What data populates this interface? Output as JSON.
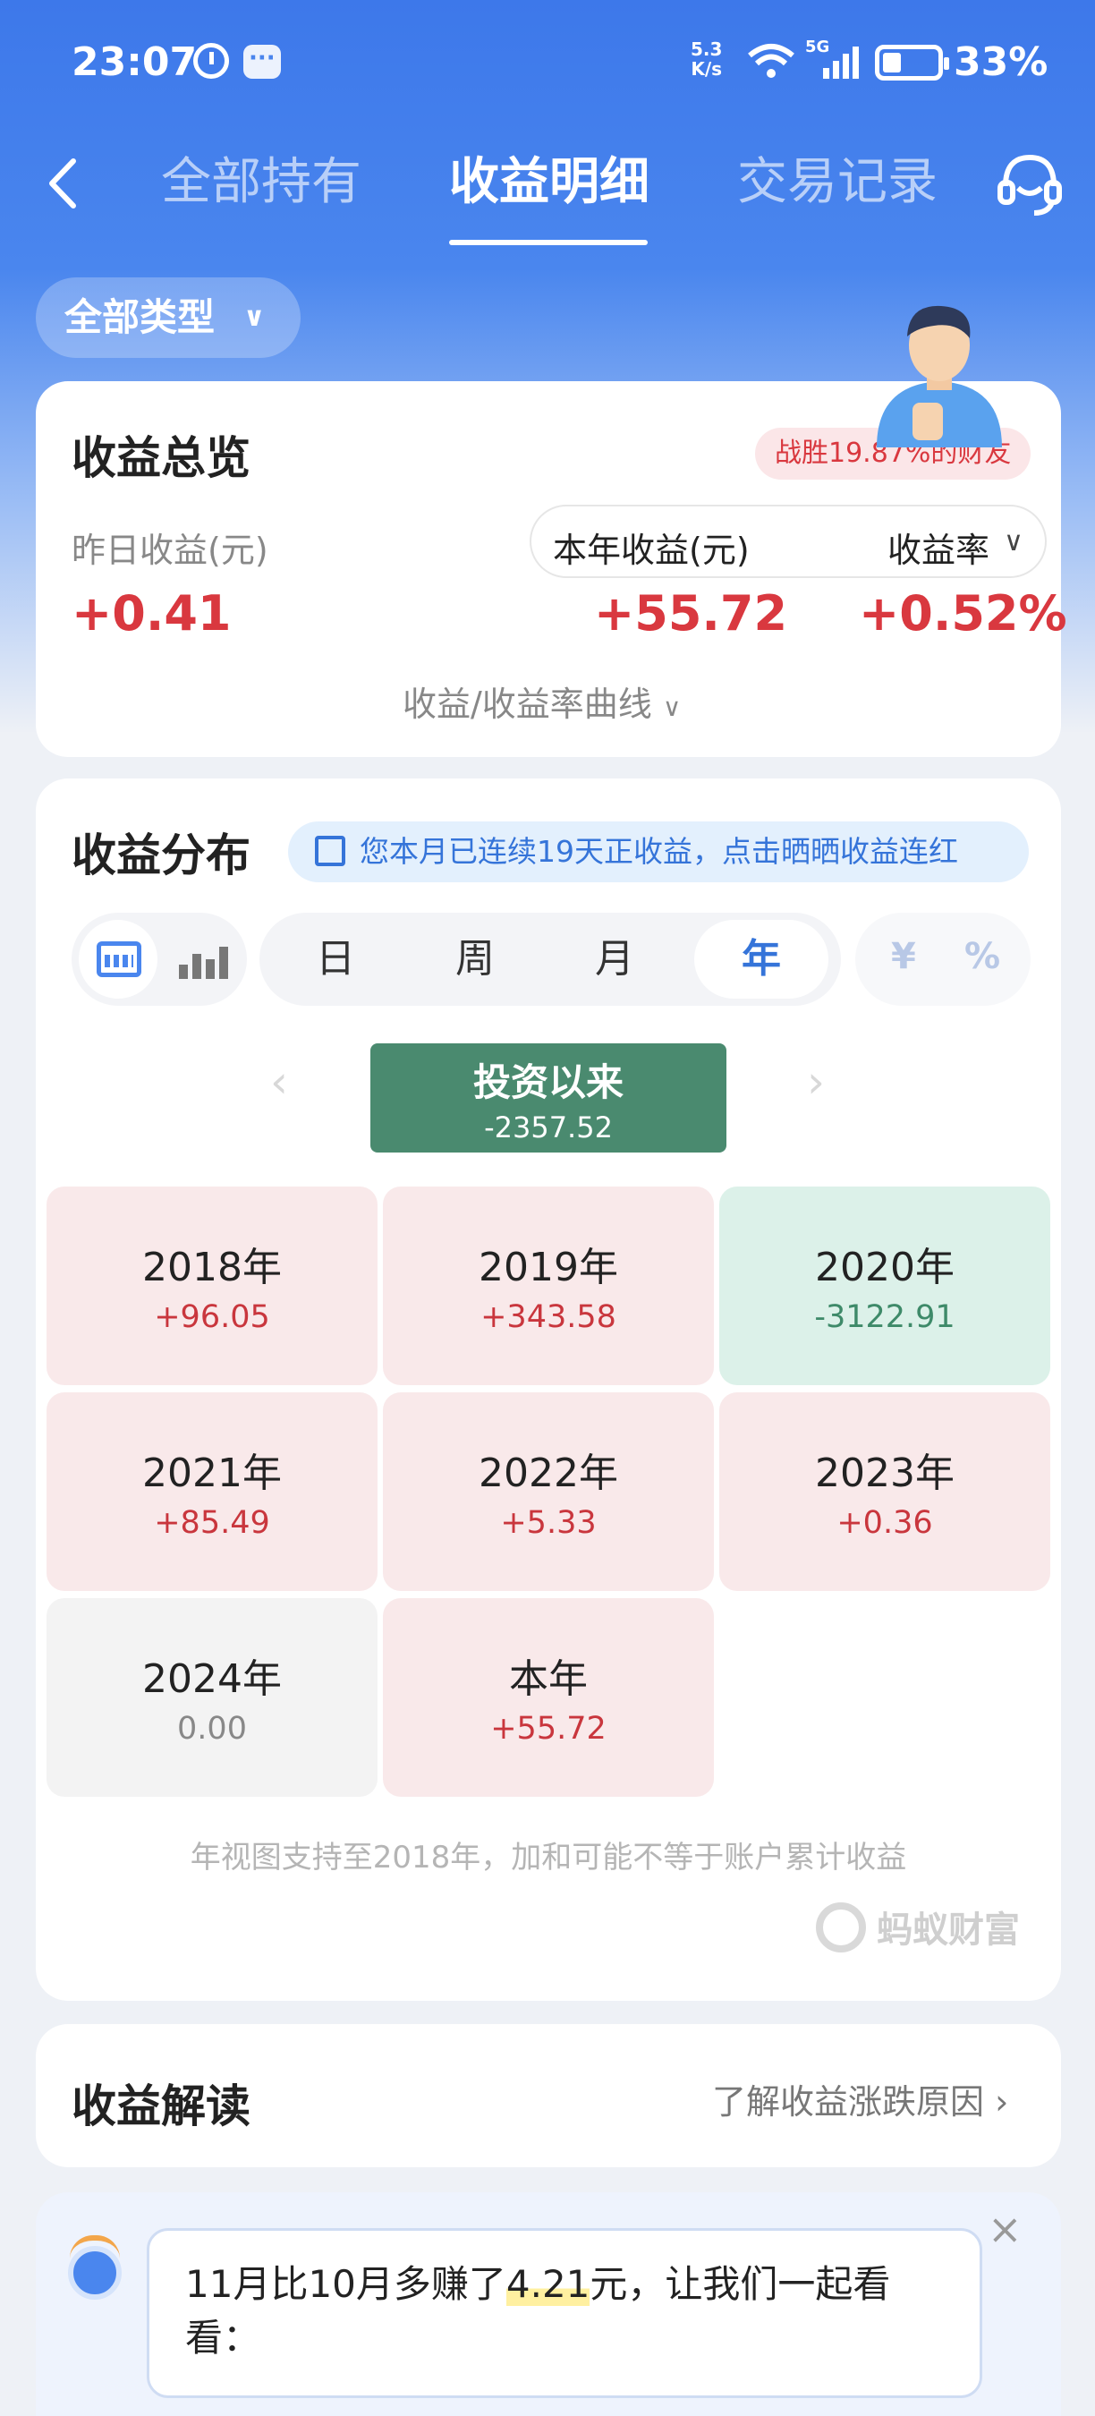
{
  "status_bar": {
    "time": "23:07",
    "speed_top": "5.3",
    "speed_bottom": "K/s",
    "network": "5G",
    "battery": "33%"
  },
  "nav": {
    "tabs": [
      {
        "label": "全部持有",
        "active": false
      },
      {
        "label": "收益明细",
        "active": true
      },
      {
        "label": "交易记录",
        "active": false
      }
    ]
  },
  "filter": {
    "label": "全部类型"
  },
  "overview": {
    "title": "收益总览",
    "beat_badge": "战胜19.87%的财友",
    "yesterday_label": "昨日收益(元)",
    "year_label": "本年收益(元)",
    "rate_label": "收益率",
    "yesterday_value": "+0.41",
    "year_value": "+55.72",
    "rate_value": "+0.52%",
    "curve_link": "收益/收益率曲线"
  },
  "distribution": {
    "title": "收益分布",
    "streak_text": "您本月已连续19天正收益，点击晒晒收益连红",
    "periods": [
      "日",
      "周",
      "月",
      "年"
    ],
    "active_period": "年",
    "units": [
      "¥",
      "%"
    ],
    "since": {
      "label": "投资以来",
      "value": "-2357.52"
    },
    "years": [
      {
        "year": "2018年",
        "value": "+96.05",
        "tone": "pos"
      },
      {
        "year": "2019年",
        "value": "+343.58",
        "tone": "pos"
      },
      {
        "year": "2020年",
        "value": "-3122.91",
        "tone": "neg"
      },
      {
        "year": "2021年",
        "value": "+85.49",
        "tone": "pos"
      },
      {
        "year": "2022年",
        "value": "+5.33",
        "tone": "pos"
      },
      {
        "year": "2023年",
        "value": "+0.36",
        "tone": "pos"
      },
      {
        "year": "2024年",
        "value": "0.00",
        "tone": "zero"
      },
      {
        "year": "本年",
        "value": "+55.72",
        "tone": "pos"
      }
    ],
    "footnote": "年视图支持至2018年，加和可能不等于账户累计收益",
    "brand": "蚂蚁财富"
  },
  "interpretation": {
    "title": "收益解读",
    "link": "了解收益涨跌原因"
  },
  "assistant": {
    "msg_before": "11月比10月多赚了",
    "msg_highlight": "4.21",
    "msg_after": "元，让我们一起看看："
  },
  "colors": {
    "brand_blue": "#4a86ee",
    "gain_red": "#d9383f",
    "loss_green": "#4a8a6f"
  }
}
